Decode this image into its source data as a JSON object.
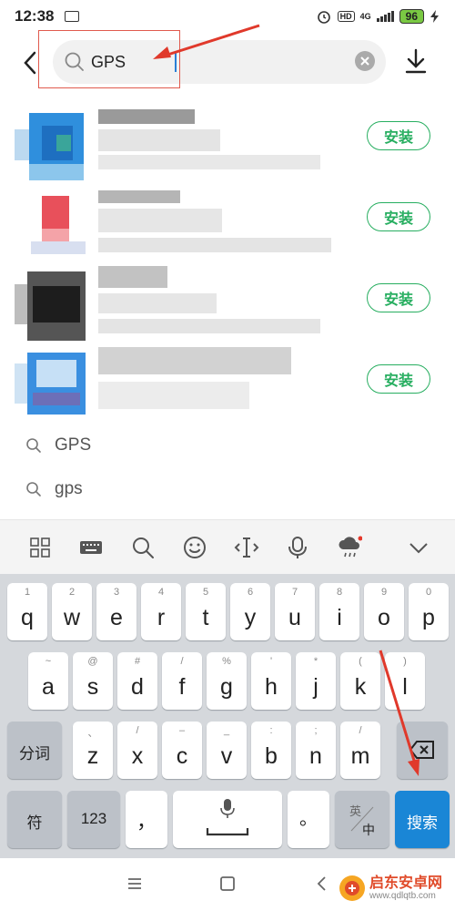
{
  "status_bar": {
    "time": "12:38",
    "hd": "HD",
    "network": "4G",
    "battery": "96"
  },
  "search": {
    "query": "GPS",
    "placeholder": ""
  },
  "apps": [
    {
      "install_label": "安装"
    },
    {
      "install_label": "安装"
    },
    {
      "install_label": "安装"
    },
    {
      "install_label": "安装"
    }
  ],
  "suggestions": [
    {
      "text": "GPS"
    },
    {
      "text": "gps"
    }
  ],
  "keyboard": {
    "row1": [
      {
        "sub": "1",
        "key": "q"
      },
      {
        "sub": "2",
        "key": "w"
      },
      {
        "sub": "3",
        "key": "e"
      },
      {
        "sub": "4",
        "key": "r"
      },
      {
        "sub": "5",
        "key": "t"
      },
      {
        "sub": "6",
        "key": "y"
      },
      {
        "sub": "7",
        "key": "u"
      },
      {
        "sub": "8",
        "key": "i"
      },
      {
        "sub": "9",
        "key": "o"
      },
      {
        "sub": "0",
        "key": "p"
      }
    ],
    "row2": [
      {
        "sub": "~",
        "key": "a"
      },
      {
        "sub": "@",
        "key": "s"
      },
      {
        "sub": "#",
        "key": "d"
      },
      {
        "sub": "/",
        "key": "f"
      },
      {
        "sub": "%",
        "key": "g"
      },
      {
        "sub": "'",
        "key": "h"
      },
      {
        "sub": "*",
        "key": "j"
      },
      {
        "sub": "(",
        "key": "k"
      },
      {
        "sub": ")",
        "key": "l"
      }
    ],
    "row3": [
      {
        "sub": "、",
        "key": "z"
      },
      {
        "sub": "/",
        "key": "x"
      },
      {
        "sub": "–",
        "key": "c"
      },
      {
        "sub": "_",
        "key": "v"
      },
      {
        "sub": ":",
        "key": "b"
      },
      {
        "sub": ";",
        "key": "n"
      },
      {
        "sub": "/",
        "key": "m"
      }
    ],
    "fenci_label": "分词",
    "symbol_label": "符",
    "num_label": "123",
    "comma_label": "，",
    "period_label": "。",
    "lang_top": "英",
    "lang_bottom": "中",
    "search_label": "搜索"
  },
  "watermark": {
    "title": "启东安卓网",
    "url": "www.qdlqtb.com"
  },
  "colors": {
    "install_green": "#27ae60",
    "search_key_blue": "#1a86d6",
    "annotation_red": "#e0392b"
  }
}
